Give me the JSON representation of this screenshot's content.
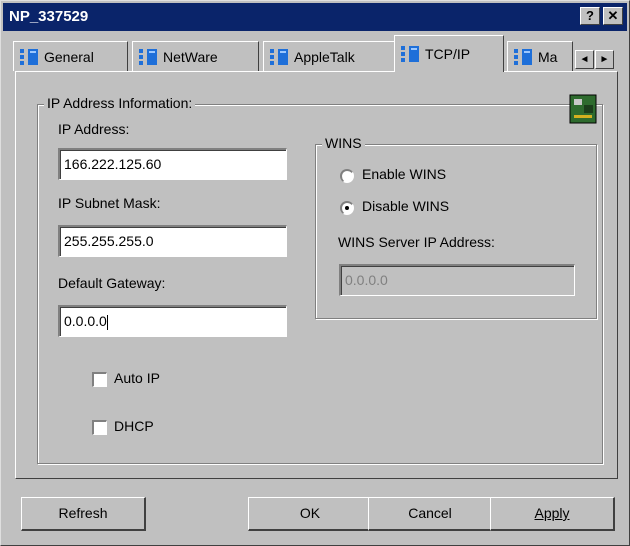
{
  "window": {
    "title": "NP_337529"
  },
  "titlebar_buttons": {
    "help": "?",
    "close": "✕"
  },
  "tabs": [
    {
      "label": "General"
    },
    {
      "label": "NetWare"
    },
    {
      "label": "AppleTalk"
    },
    {
      "label": "TCP/IP",
      "active": true
    },
    {
      "label": "Ma"
    }
  ],
  "tab_scroll": {
    "left": "◄",
    "right": "►"
  },
  "ip_group": {
    "title": "IP Address Information:",
    "ip_address_label": "IP Address:",
    "ip_address_value": "166.222.125.60",
    "subnet_label": "IP Subnet Mask:",
    "subnet_value": "255.255.255.0",
    "gateway_label": "Default Gateway:",
    "gateway_value": "0.0.0.0"
  },
  "wins": {
    "title": "WINS",
    "enable_label": "Enable WINS",
    "disable_label": "Disable WINS",
    "selected": "disable",
    "server_label": "WINS Server IP Address:",
    "server_value": "0.0.0.0"
  },
  "options": {
    "auto_ip_label": "Auto IP",
    "auto_ip_checked": false,
    "dhcp_label": "DHCP",
    "dhcp_checked": false
  },
  "buttons": {
    "refresh": "Refresh",
    "ok": "OK",
    "cancel": "Cancel",
    "apply": "Apply"
  },
  "colors": {
    "face": "#c0c0c0",
    "titlebar": "#0a246a",
    "tab_icon": "#1e6fd9"
  }
}
